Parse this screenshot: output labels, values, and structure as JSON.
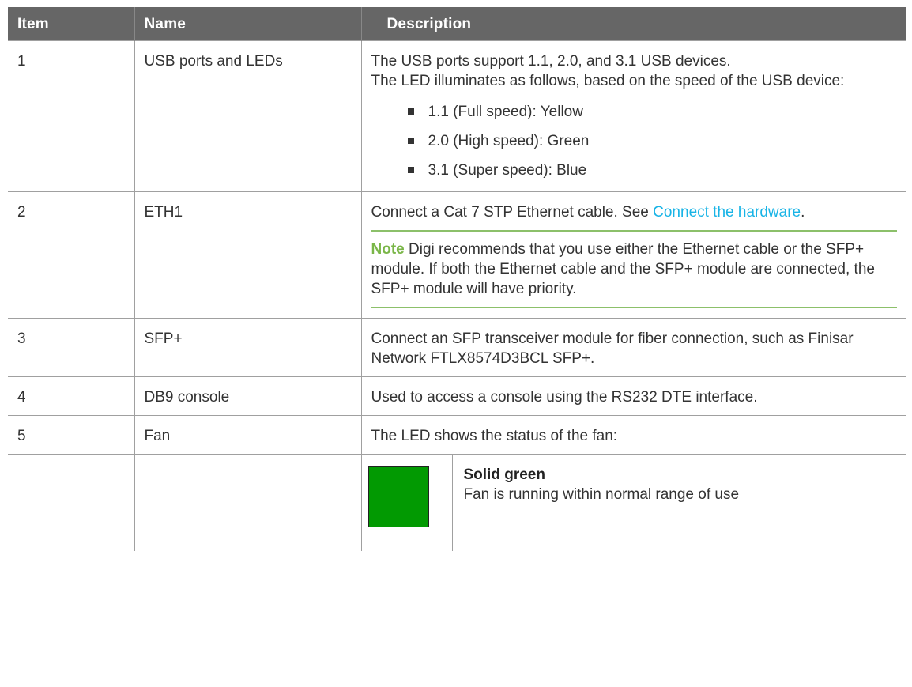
{
  "table": {
    "headers": {
      "item": "Item",
      "name": "Name",
      "description": "Description"
    },
    "rows": [
      {
        "item": "1",
        "name": "USB ports and LEDs",
        "desc_line1": "The USB ports support 1.1, 2.0, and 3.1 USB devices.",
        "desc_line2": "The LED illuminates as follows, based on the speed of the USB device:",
        "bullets": [
          "1.1 (Full speed): Yellow",
          "2.0 (High speed): Green",
          "3.1 (Super speed): Blue"
        ]
      },
      {
        "item": "2",
        "name": "ETH1",
        "desc_text": "Connect a Cat 7 STP Ethernet cable. See ",
        "desc_link": "Connect the hardware",
        "desc_after_link": ".",
        "note_label": "Note",
        "note_text": " Digi recommends that you use either the Ethernet cable or the SFP+ module. If both the Ethernet cable and the SFP+ module are connected, the SFP+ module will have priority."
      },
      {
        "item": "3",
        "name": "SFP+",
        "desc": "Connect an SFP transceiver module for fiber connection, such as Finisar Network FTLX8574D3BCL SFP+."
      },
      {
        "item": "4",
        "name": "DB9 console",
        "desc": "Used to access a console using the RS232 DTE interface."
      },
      {
        "item": "5",
        "name": "Fan",
        "desc": "The LED shows the status of the fan:"
      }
    ],
    "led": {
      "color": "#029a02",
      "title": "Solid green",
      "text": "Fan is running within normal range of use"
    }
  },
  "colors": {
    "header_bg": "#666666",
    "link": "#19b4e6",
    "note_accent": "#7ab648",
    "led_green": "#029a02"
  }
}
